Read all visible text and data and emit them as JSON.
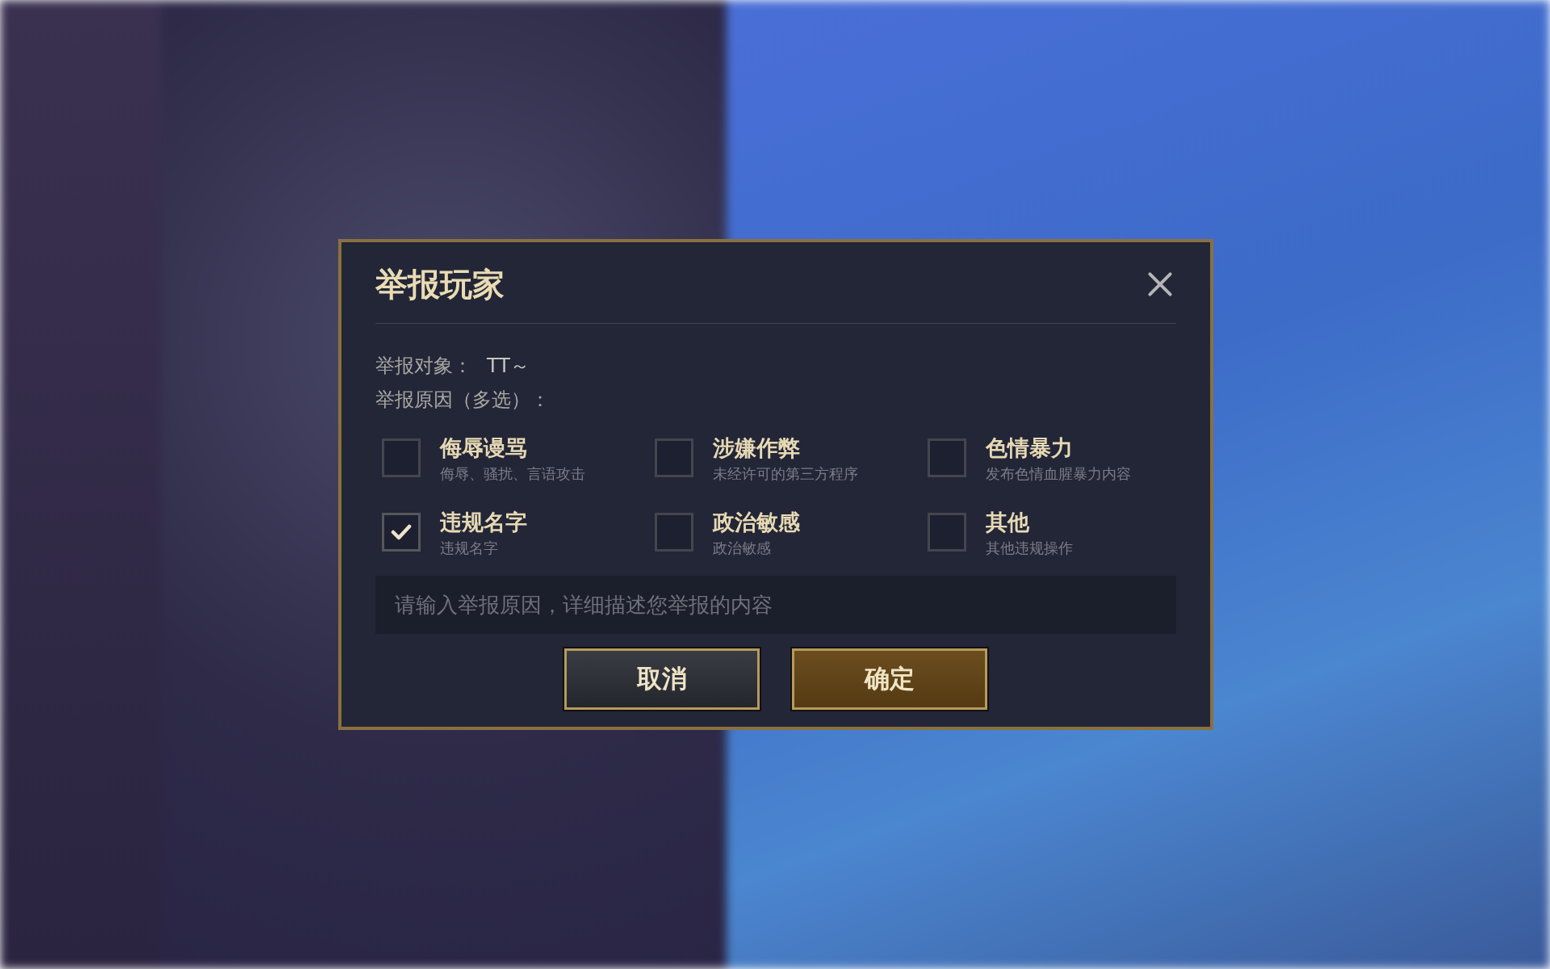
{
  "dialog": {
    "title": "举报玩家",
    "target_label": "举报对象：",
    "target_value": "TT～",
    "reasons_label": "举报原因（多选）：",
    "options": [
      {
        "title": "侮辱谩骂",
        "description": "侮辱、骚扰、言语攻击",
        "checked": false
      },
      {
        "title": "涉嫌作弊",
        "description": "未经许可的第三方程序",
        "checked": false
      },
      {
        "title": "色情暴力",
        "description": "发布色情血腥暴力内容",
        "checked": false
      },
      {
        "title": "违规名字",
        "description": "违规名字",
        "checked": true
      },
      {
        "title": "政治敏感",
        "description": "政治敏感",
        "checked": false
      },
      {
        "title": "其他",
        "description": "其他违规操作",
        "checked": false
      }
    ],
    "input": {
      "placeholder": "请输入举报原因，详细描述您举报的内容"
    },
    "buttons": [
      {
        "label": "取消",
        "kind": "secondary"
      },
      {
        "label": "确定",
        "kind": "primary"
      }
    ]
  }
}
